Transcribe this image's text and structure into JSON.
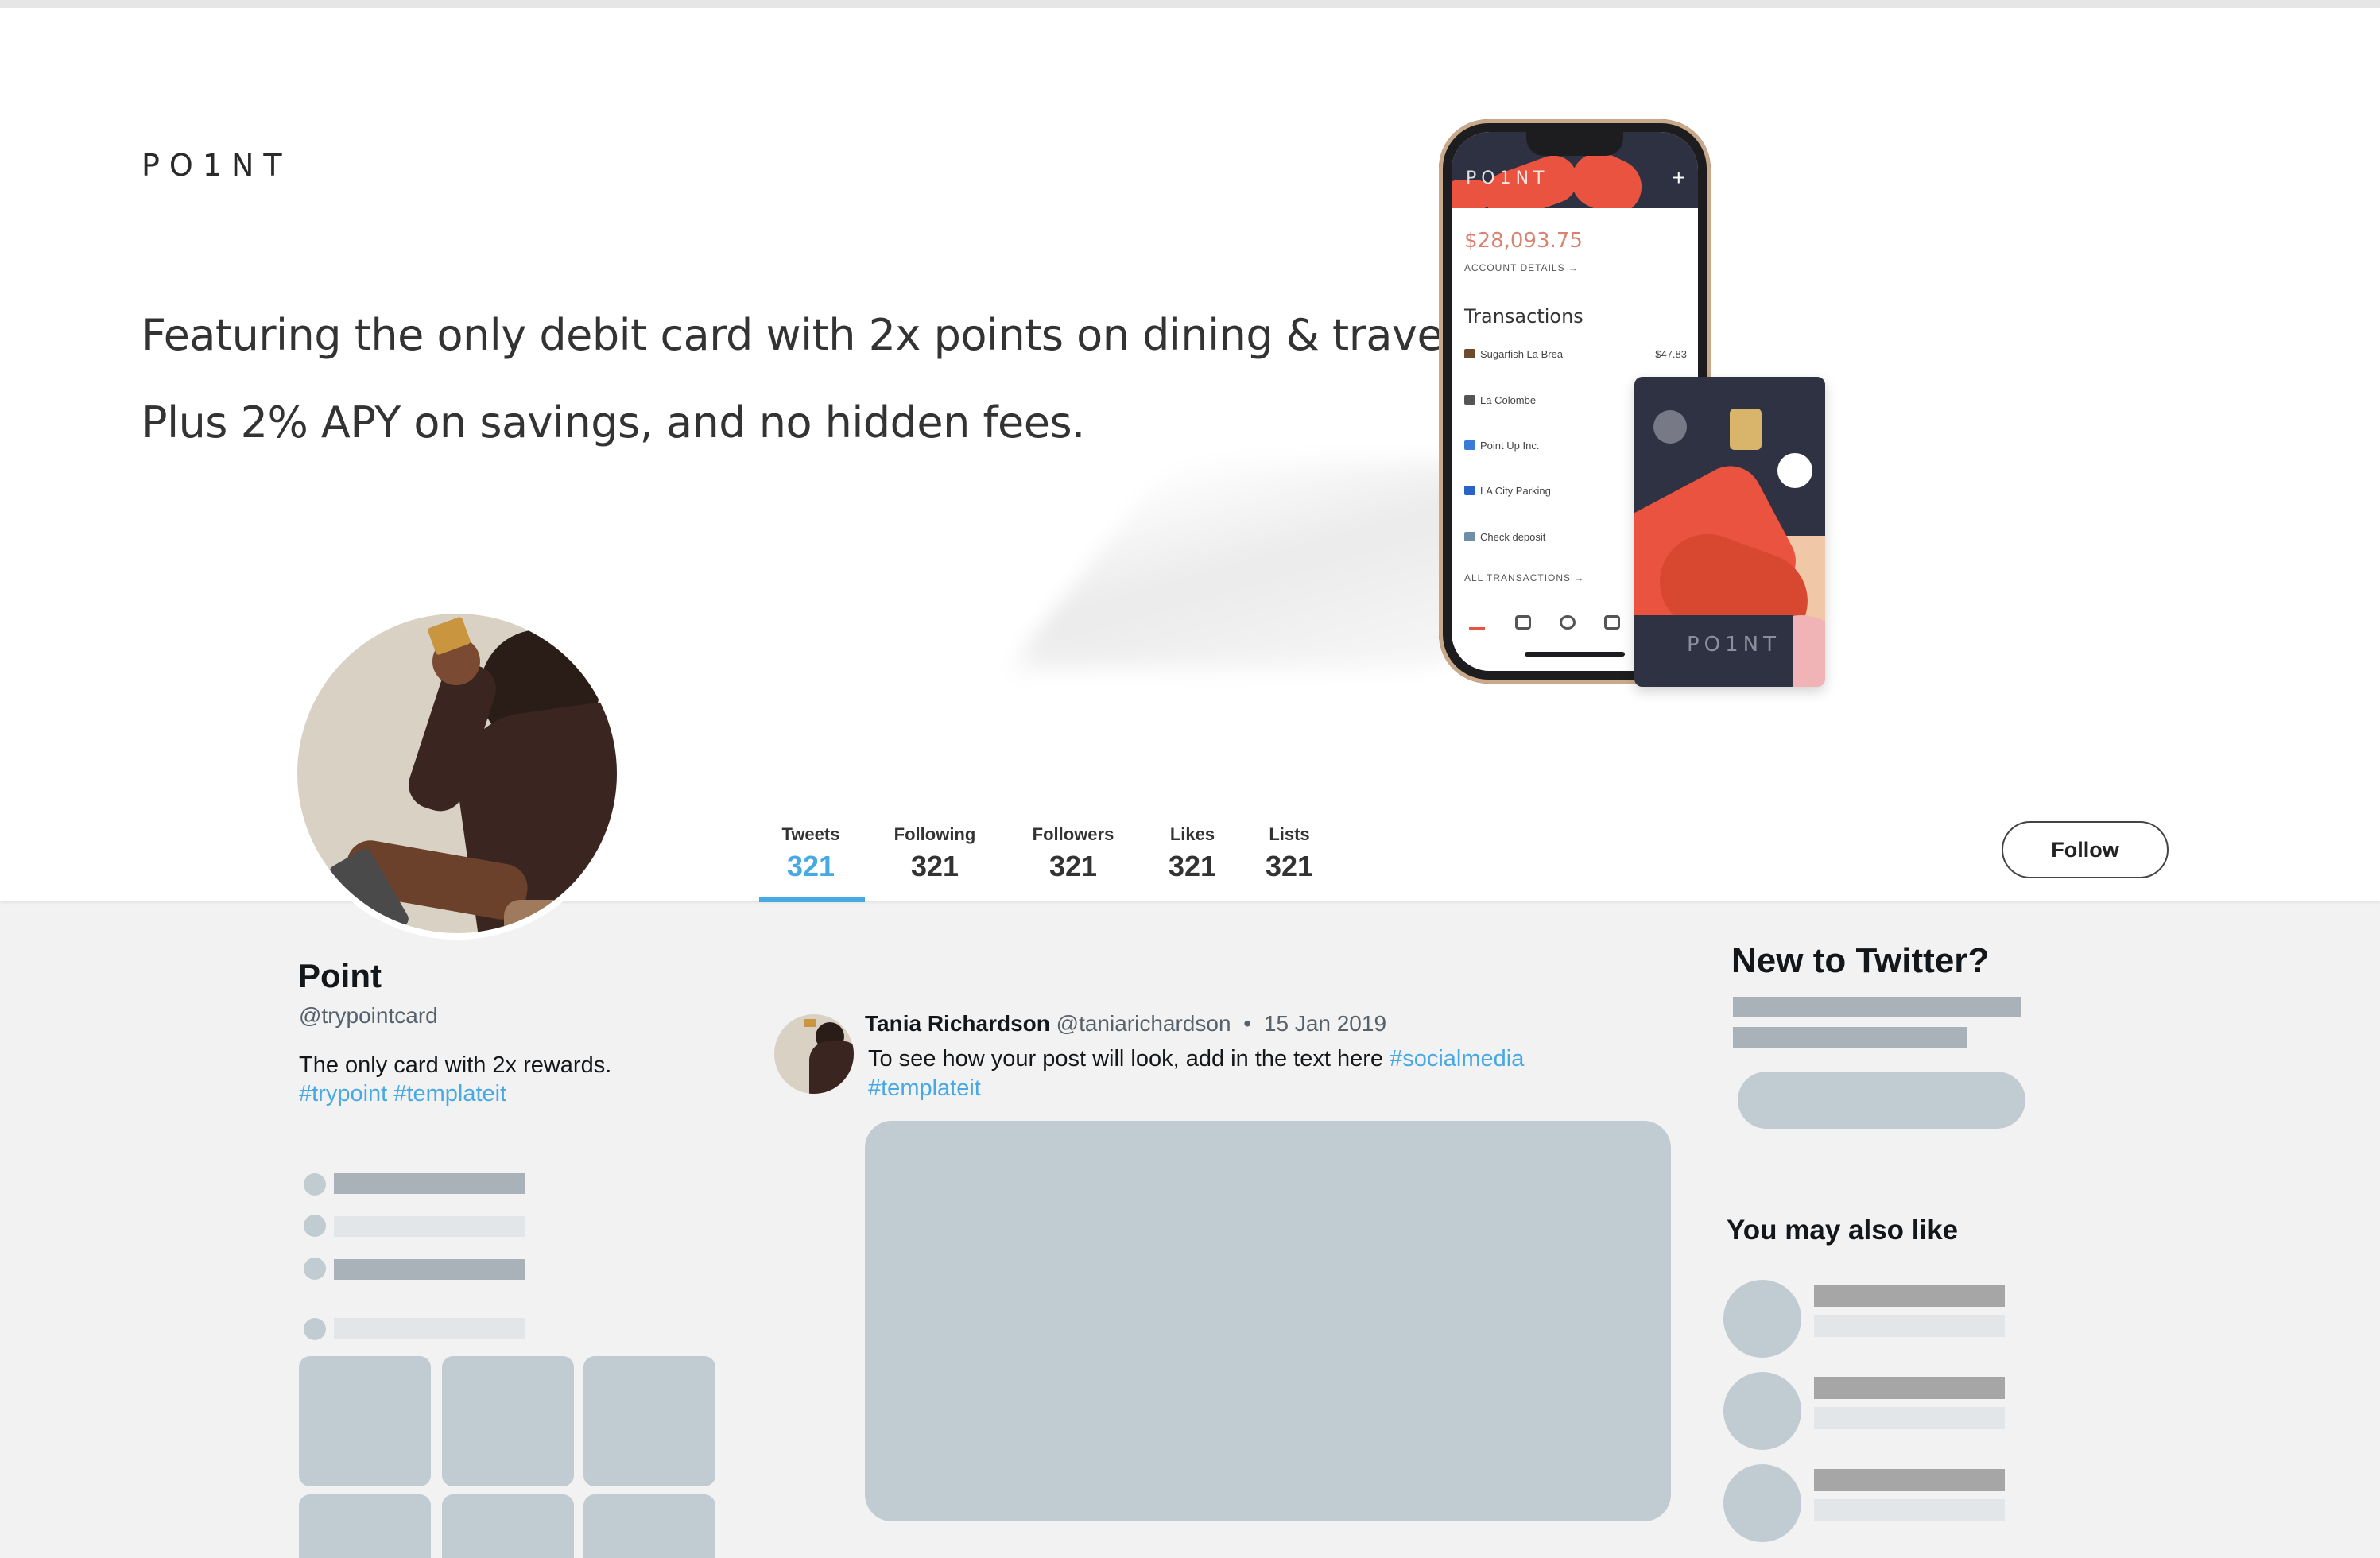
{
  "banner": {
    "brand": "PO1NT",
    "tagline_line1": "Featuring the only debit card with 2x points on dining & travel.",
    "tagline_line2": "Plus 2% APY on savings, and no hidden fees.",
    "phone": {
      "brand": "PO1NT",
      "balance": "$28,093.75",
      "account_details": "ACCOUNT DETAILS →",
      "transactions_title": "Transactions",
      "transactions": [
        {
          "name": "Sugarfish La Brea",
          "amount": "$47.83"
        },
        {
          "name": "La Colombe",
          "amount": ""
        },
        {
          "name": "Point Up Inc.",
          "amount": ""
        },
        {
          "name": "LA City Parking",
          "amount": ""
        },
        {
          "name": "Check deposit",
          "amount": ""
        }
      ],
      "all_transactions": "ALL TRANSACTIONS →"
    },
    "card_brand": "PO1NT"
  },
  "stats": {
    "tweets": {
      "label": "Tweets",
      "value": "321"
    },
    "following": {
      "label": "Following",
      "value": "321"
    },
    "followers": {
      "label": "Followers",
      "value": "321"
    },
    "likes": {
      "label": "Likes",
      "value": "321"
    },
    "lists": {
      "label": "Lists",
      "value": "321"
    }
  },
  "follow_label": "Follow",
  "profile": {
    "name": "Point",
    "handle": "@trypointcard",
    "bio": "The only card with 2x rewards.",
    "tags": "#trypoint #templateit"
  },
  "tweet": {
    "author": "Tania Richardson",
    "handle": "@taniarichardson",
    "separator": "•",
    "date": "15 Jan 2019",
    "text": "To see how your post will look, add in the text here",
    "hashtag1": "#socialmedia",
    "hashtag2": "#templateit"
  },
  "sidebar": {
    "new_title": "New to Twitter?",
    "also_title": "You may also like"
  },
  "colors": {
    "accent": "#47a9e4",
    "placeholder": "#c0ccd1",
    "brand_red": "#e9533f",
    "brand_navy": "#2e3242"
  }
}
